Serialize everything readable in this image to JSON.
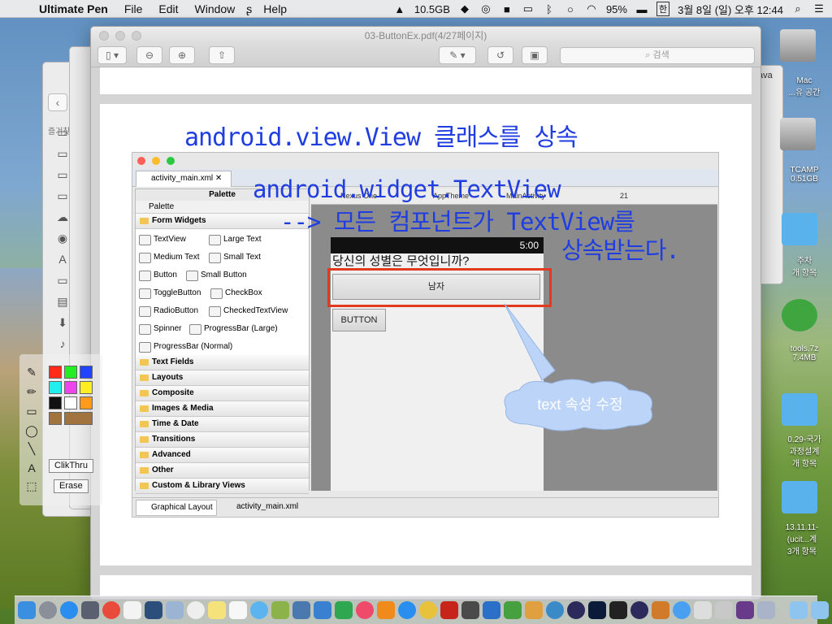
{
  "menubar": {
    "apple": "",
    "app_name": "Ultimate Pen",
    "items": [
      "File",
      "Edit",
      "Window",
      "Help"
    ],
    "status": {
      "memory": "10.5GB",
      "battery": "95%",
      "input": "한",
      "datetime": "3월 8일 (일) 오후 12:44"
    }
  },
  "window": {
    "title": "03-ButtonEx.pdf(4/27페이지)",
    "search_placeholder": "검색"
  },
  "slide": {
    "title": "android.view.View 클래스를 상속",
    "overlay_line1": "android.widget.TextView",
    "overlay_line2": "--> 모든 컴포넌트가 TextView를",
    "overlay_line3": "상속받는다."
  },
  "eclipse": {
    "tab": "activity_main.xml",
    "palette_header": "Palette",
    "palette_bar": "Palette",
    "form_widgets": "Form Widgets",
    "widgets": [
      "TextView",
      "Large Text",
      "Medium Text",
      "Small Text",
      "Button",
      "Small Button",
      "ToggleButton",
      "CheckBox",
      "RadioButton",
      "CheckedTextView",
      "Spinner",
      "ProgressBar (Large)",
      "ProgressBar (Normal)"
    ],
    "categories": [
      "Text Fields",
      "Layouts",
      "Composite",
      "Images & Media",
      "Time & Date",
      "Transitions",
      "Advanced",
      "Other",
      "Custom & Library Views"
    ],
    "bottom_tabs": [
      "Graphical Layout",
      "activity_main.xml"
    ],
    "canvas_toolbar": {
      "device": "Nexus One",
      "theme": "AppTheme",
      "activity": "MainActivity",
      "api": "21"
    },
    "phone": {
      "time": "5:00",
      "question": "당신의 성별은 무엇입니까?",
      "button1": "남자",
      "button2": "BUTTON"
    },
    "callout": "text 속성 수정"
  },
  "desktop": {
    "items": [
      {
        "label": "Mac\n...유 공간"
      },
      {
        "label": "TCAMP\n0.51GB"
      },
      {
        "label": "주차\n개 항목"
      },
      {
        "label": "tools.7z\n7.4MB"
      },
      {
        "label": "0.29-국가\n과정설계\n개 항목"
      },
      {
        "label": "13.11.11-\n(ucit...계\n3개 항목"
      }
    ],
    "java_label": "ava",
    "left_label": "즐겨찾"
  },
  "pen": {
    "tooltip1": "ClikThru",
    "tooltip2": "Erase",
    "colors": [
      "#ff2a1a",
      "#22ee22",
      "#2244ff",
      "#22eeee",
      "#ee44ee",
      "#ffee22",
      "#111111",
      "#ffffff",
      "#ff9a1a",
      "#a0733f",
      "#a0733f"
    ]
  }
}
